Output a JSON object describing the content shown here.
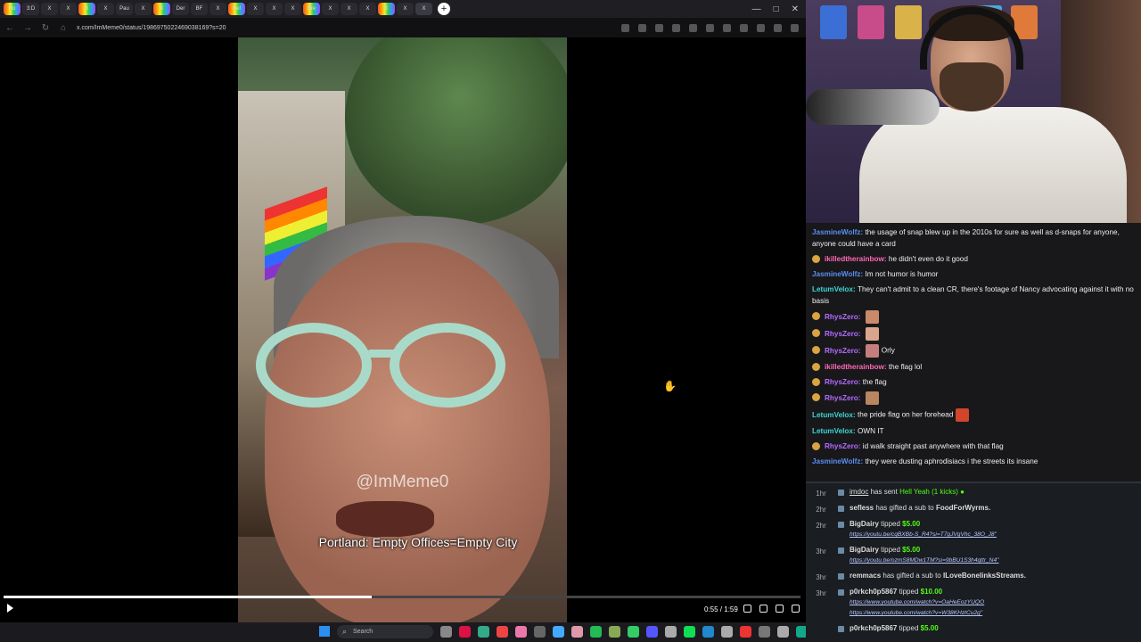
{
  "browser": {
    "tabs": [
      {
        "label": "Ho"
      },
      {
        "label": "3:D"
      },
      {
        "label": "X"
      },
      {
        "label": "X"
      },
      {
        "label": "X"
      },
      {
        "label": "X"
      },
      {
        "label": "Pau"
      },
      {
        "label": "X"
      },
      {
        "label": "X"
      },
      {
        "label": "Der"
      },
      {
        "label": "BF"
      },
      {
        "label": "X"
      },
      {
        "label": "Kel"
      },
      {
        "label": "X"
      },
      {
        "label": "X"
      },
      {
        "label": "X"
      },
      {
        "label": "Bre"
      },
      {
        "label": "X"
      },
      {
        "label": "X"
      },
      {
        "label": "X"
      },
      {
        "label": "X"
      },
      {
        "label": "X"
      },
      {
        "label": "X"
      }
    ],
    "url": "x.com/ImMeme0/status/1986975022469038169?s=20",
    "window_controls": [
      "—",
      "□",
      "✕"
    ]
  },
  "video": {
    "watermark": "@ImMeme0",
    "caption": "Portland: Empty Offices=Empty City",
    "time": "0:55 / 1:59",
    "progress": 0.462
  },
  "taskbar": {
    "search_placeholder": "Search",
    "icon_colors": [
      "#888",
      "#d14",
      "#3a8",
      "#e44",
      "#e7a",
      "#666",
      "#4af",
      "#d9a",
      "#2b5",
      "#8a5",
      "#3c6",
      "#55f",
      "#aaa",
      "#1d5",
      "#28c",
      "#aaa",
      "#e33",
      "#777",
      "#aaa",
      "#1a8",
      "#ddd",
      "#53fc18"
    ]
  },
  "chat": {
    "messages": [
      {
        "user": "JasmineWolfz",
        "color": "#5b8def",
        "badge": false,
        "text": "the usage of snap blew up in the 2010s for sure as well as d-snaps for anyone, anyone could have a card",
        "emote": null
      },
      {
        "user": "ikilledtherainbow",
        "color": "#ff69b4",
        "badge": true,
        "text": "he didn't even do it good",
        "emote": null
      },
      {
        "user": "JasmineWolfz",
        "color": "#5b8def",
        "badge": false,
        "text": "Im not humor is humor",
        "emote": null
      },
      {
        "user": "LetumVelox",
        "color": "#3dd6d0",
        "badge": false,
        "text": "They can't admit to a clean CR, there's footage of Nancy advocating against it with no basis",
        "emote": null
      },
      {
        "user": "RhysZero",
        "color": "#b36bff",
        "badge": true,
        "text": "",
        "emote": "#c98a6a"
      },
      {
        "user": "RhysZero",
        "color": "#b36bff",
        "badge": true,
        "text": "",
        "emote": "#d9a58c"
      },
      {
        "user": "RhysZero",
        "color": "#b36bff",
        "badge": true,
        "text": "Orly",
        "emote": "#c47e7e"
      },
      {
        "user": "ikilledtherainbow",
        "color": "#ff69b4",
        "badge": true,
        "text": "the flag lol",
        "emote": null
      },
      {
        "user": "RhysZero",
        "color": "#b36bff",
        "badge": true,
        "text": "the flag",
        "emote": null
      },
      {
        "user": "RhysZero",
        "color": "#b36bff",
        "badge": true,
        "text": "",
        "emote": "#b8865f"
      },
      {
        "user": "LetumVelox",
        "color": "#3dd6d0",
        "badge": false,
        "text": "the pride flag on her forehead",
        "emote": "#d0452c"
      },
      {
        "user": "LetumVelox",
        "color": "#3dd6d0",
        "badge": false,
        "text": "OWN IT",
        "emote": null
      },
      {
        "user": "RhysZero",
        "color": "#b36bff",
        "badge": true,
        "text": "id walk straight past anywhere with that flag",
        "emote": null
      },
      {
        "user": "JasmineWolfz",
        "color": "#5b8def",
        "badge": false,
        "text": "they were dusting aphrodisiacs i the streets its insane",
        "emote": null
      }
    ]
  },
  "events": [
    {
      "time": "1hr",
      "user": "imdoc",
      "underline": true,
      "text": "has sent",
      "highlight": "Hell Yeah (1 kicks)",
      "link": "",
      "amount": ""
    },
    {
      "time": "2hr",
      "user": "sefless",
      "underline": false,
      "text": "has gifted a sub to",
      "target": "FoodForWyrms.",
      "highlight": "",
      "link": "",
      "amount": ""
    },
    {
      "time": "2hr",
      "user": "BigDairy",
      "underline": false,
      "text": "tipped",
      "amount": "$5.00",
      "link": "https://youtu.be/cqBXBb-S_R4?si=T7gJVgVhc_38O_J8\""
    },
    {
      "time": "3hr",
      "user": "BigDairy",
      "underline": false,
      "text": "tipped",
      "amount": "$5.00",
      "link": "https://youtu.be/ozmS8MDw1TM?si=9bBU1S3h4qttr_N4\""
    },
    {
      "time": "3hr",
      "user": "remmacs",
      "underline": false,
      "text": "has gifted a sub to",
      "target": "ILoveBonelinksStreams.",
      "highlight": "",
      "link": "",
      "amount": ""
    },
    {
      "time": "3hr",
      "user": "p0rkch0p5867",
      "underline": false,
      "text": "tipped",
      "amount": "$10.00",
      "link": "https://www.youtube.com/watch?v=OaHeEozYUQO",
      "link2": "https://www.youtube.com/watch?v=W38KHztCu2g\""
    },
    {
      "time": "",
      "user": "p0rkch0p5867",
      "underline": false,
      "text": "tipped",
      "amount": "$5.00",
      "link": ""
    }
  ]
}
